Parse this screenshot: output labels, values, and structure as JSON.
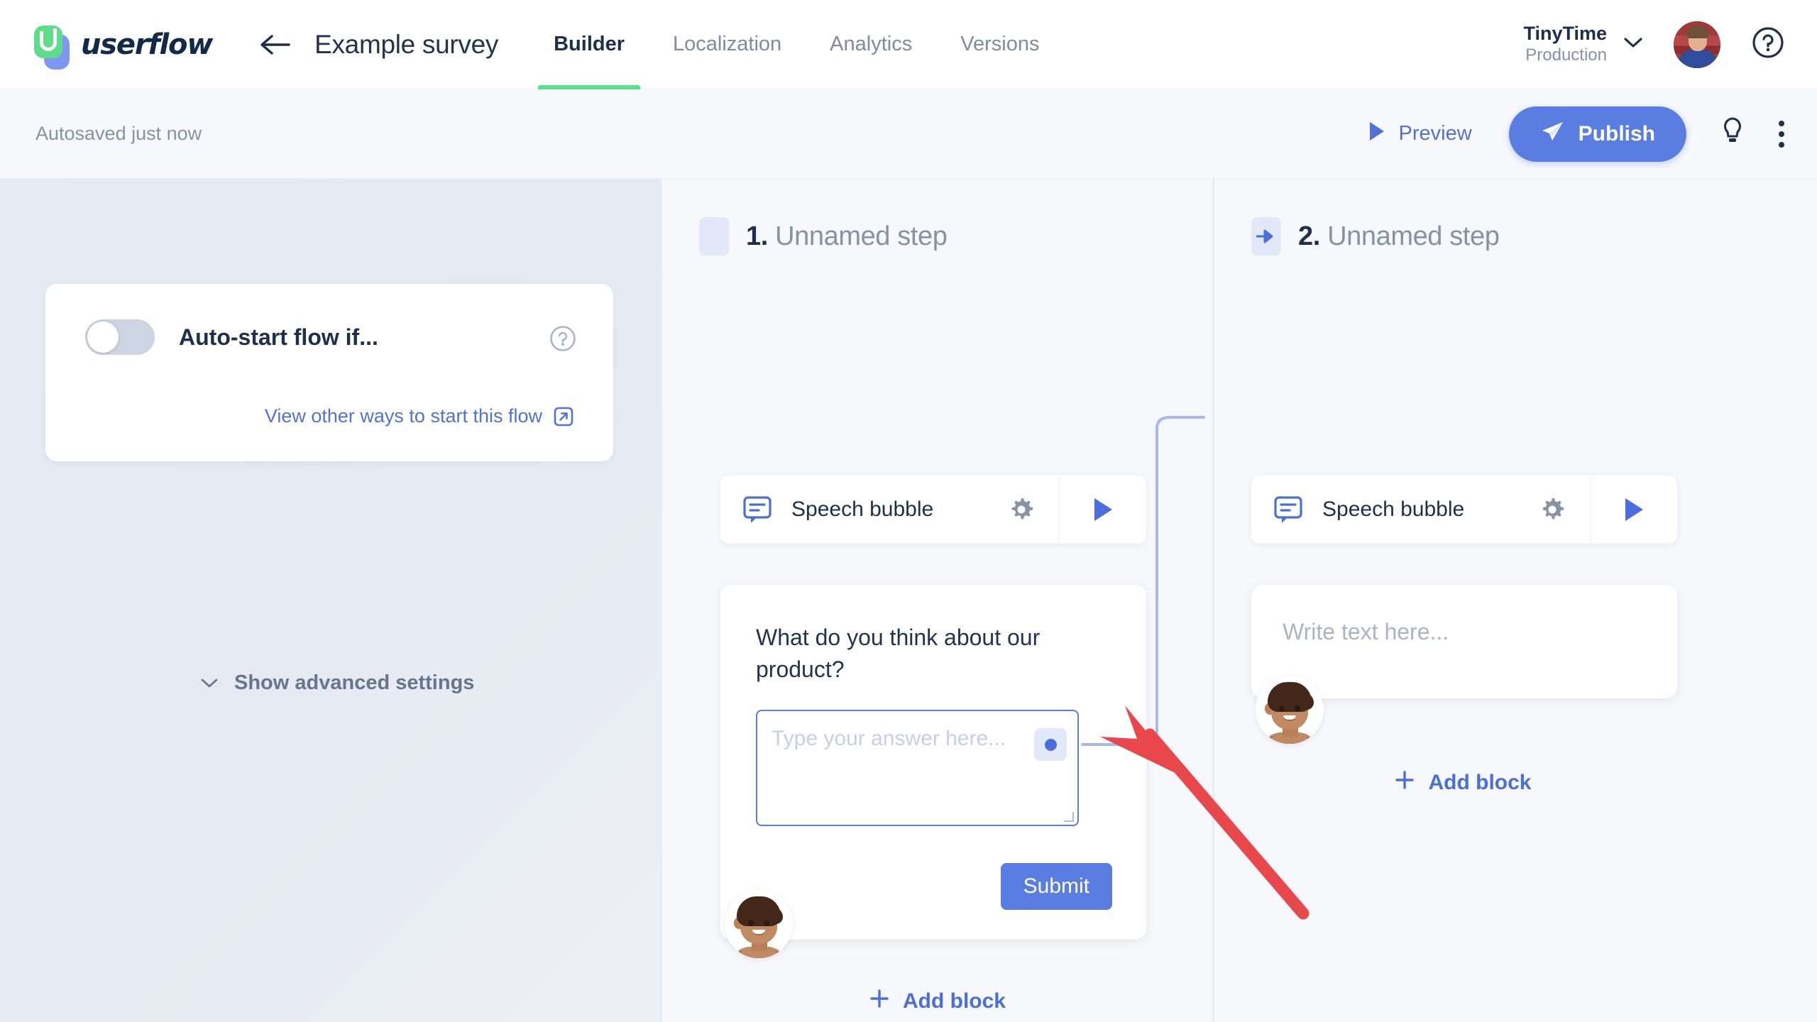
{
  "header": {
    "logo_text": "userflow",
    "logo_icon": "userflow-logo-icon",
    "back_icon": "back-arrow-icon",
    "flow_title": "Example survey",
    "tabs": [
      {
        "label": "Builder",
        "active": true
      },
      {
        "label": "Localization",
        "active": false
      },
      {
        "label": "Analytics",
        "active": false
      },
      {
        "label": "Versions",
        "active": false
      }
    ],
    "org": {
      "name": "TinyTime",
      "env": "Production",
      "chevron_icon": "chevron-down-icon"
    },
    "avatar_icon": "user-avatar-photo",
    "help_icon": "question-mark-circle-icon"
  },
  "toolbar": {
    "autosave_text": "Autosaved just now",
    "preview_label": "Preview",
    "preview_icon": "play-icon",
    "publish_label": "Publish",
    "publish_icon": "paper-plane-icon",
    "bulb_icon": "lightbulb-icon",
    "kebab_icon": "more-vertical-icon"
  },
  "left_panel": {
    "autostart_label": "Auto-start flow if...",
    "autostart_enabled": false,
    "card_help_icon": "question-mark-circle-icon",
    "view_other_label": "View other ways to start this flow",
    "view_other_icon": "external-link-icon",
    "show_advanced_label": "Show advanced settings",
    "show_advanced_icon": "chevron-down-icon"
  },
  "canvas": {
    "steps": [
      {
        "number": "1.",
        "name": "Unnamed step",
        "header_chip_icon": "step-handle",
        "block": {
          "icon": "speech-bubble-icon",
          "label": "Speech bubble",
          "gear_icon": "gear-icon",
          "play_icon": "play-icon"
        },
        "bubble": {
          "question": "What do you think about our product?",
          "answer_placeholder": "Type your answer here...",
          "answer_value": "",
          "submit_label": "Submit"
        },
        "persona_icon": "persona-avatar-icon",
        "add_block_label": "Add block",
        "add_block_icon": "plus-icon"
      },
      {
        "number": "2.",
        "name": "Unnamed step",
        "header_chip_icon": "connector-arrow-icon",
        "block": {
          "icon": "speech-bubble-icon",
          "label": "Speech bubble",
          "gear_icon": "gear-icon",
          "play_icon": "play-icon"
        },
        "bubble": {
          "text_placeholder": "Write text here...",
          "text_value": ""
        },
        "persona_icon": "persona-avatar-icon",
        "add_block_label": "Add block",
        "add_block_icon": "plus-icon"
      }
    ],
    "connector": {
      "source_node_icon": "connector-dot",
      "target_node_icon": "connector-arrow-icon"
    },
    "annotation_icon": "red-pointer-arrow"
  },
  "colors": {
    "brand_green": "#58e08d",
    "brand_blue": "#5a7de2",
    "link_blue": "#5273d6",
    "text_dark": "#1c2f4d",
    "text_muted": "#8592a6",
    "annotation_red": "#e8474c"
  }
}
